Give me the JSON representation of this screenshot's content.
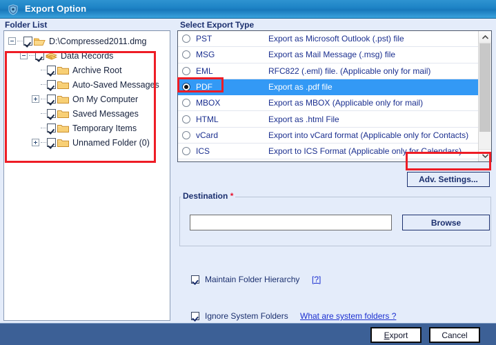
{
  "window": {
    "title": "Export Option",
    "icon": "app-shield-icon"
  },
  "folder_list": {
    "group_label": "Folder List",
    "tree": [
      {
        "label": "D:\\Compressed2011.dmg",
        "depth": 0,
        "expander": "minus",
        "checked": true,
        "icon": "open-folder-icon"
      },
      {
        "label": "Data Records",
        "depth": 1,
        "expander": "minus",
        "checked": true,
        "icon": "archive-folder-icon"
      },
      {
        "label": "Archive Root",
        "depth": 2,
        "expander": "none",
        "checked": true,
        "icon": "folder-icon"
      },
      {
        "label": "Auto-Saved Messages",
        "depth": 2,
        "expander": "none",
        "checked": true,
        "icon": "folder-icon"
      },
      {
        "label": "On My Computer",
        "depth": 2,
        "expander": "plus",
        "checked": true,
        "icon": "folder-icon"
      },
      {
        "label": "Saved Messages",
        "depth": 2,
        "expander": "none",
        "checked": true,
        "icon": "folder-icon"
      },
      {
        "label": "Temporary Items",
        "depth": 2,
        "expander": "none",
        "checked": true,
        "icon": "folder-icon"
      },
      {
        "label": "Unnamed Folder (0)",
        "depth": 2,
        "expander": "plus",
        "checked": true,
        "icon": "folder-icon"
      }
    ]
  },
  "export_type": {
    "group_label": "Select Export Type",
    "selected": "PDF",
    "rows": [
      {
        "name": "PST",
        "desc": "Export as Microsoft Outlook (.pst) file",
        "selected": false
      },
      {
        "name": "MSG",
        "desc": "Export as Mail Message (.msg) file",
        "selected": false
      },
      {
        "name": "EML",
        "desc": "RFC822 (.eml) file. (Applicable only for mail)",
        "selected": false
      },
      {
        "name": "PDF",
        "desc": "Export as .pdf file",
        "selected": true
      },
      {
        "name": "MBOX",
        "desc": "Export as MBOX (Applicable only for mail)",
        "selected": false
      },
      {
        "name": "HTML",
        "desc": "Export as .html File",
        "selected": false
      },
      {
        "name": "vCard",
        "desc": "Export into vCard format (Applicable only for Contacts)",
        "selected": false
      },
      {
        "name": "ICS",
        "desc": "Export to ICS Format (Applicable only for Calendars)",
        "selected": false
      }
    ],
    "scrollbar": {
      "up_icon": "chevron-up-icon",
      "down_icon": "chevron-down-icon"
    }
  },
  "adv_settings": {
    "label": "Adv. Settings..."
  },
  "destination": {
    "group_label": "Destination",
    "required_marker": "*",
    "value": "",
    "placeholder": "",
    "browse_label": "Browse"
  },
  "options": {
    "maintain_folder_hierarchy": {
      "label": "Maintain Folder Hierarchy",
      "checked": true,
      "help": "[?]"
    },
    "ignore_system_folders": {
      "label": "Ignore System Folders",
      "checked": true,
      "help": "What are system folders ?"
    }
  },
  "footer": {
    "export_accel": "E",
    "export_rest": "xport",
    "cancel_label": "Cancel"
  },
  "colors": {
    "titlebar": "#1e84c6",
    "selection": "#3399f5",
    "annotation": "#ee1c25",
    "footer": "#3c6096",
    "label_text": "#1b2f6e",
    "required": "#e8112d"
  }
}
